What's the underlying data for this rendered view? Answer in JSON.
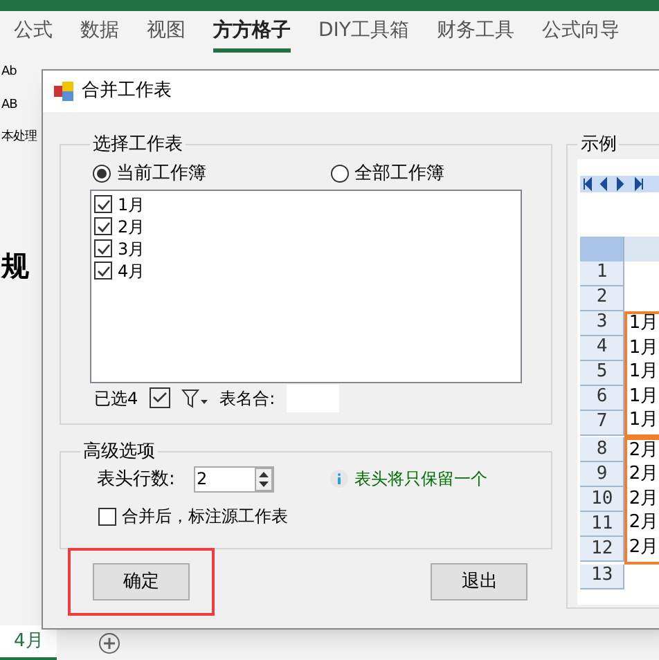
{
  "ribbon": {
    "tabs": [
      {
        "label": "公式",
        "selected": false
      },
      {
        "label": "数据",
        "selected": false
      },
      {
        "label": "视图",
        "selected": false
      },
      {
        "label": "方方格子",
        "selected": true
      },
      {
        "label": "DIY工具箱",
        "selected": false
      },
      {
        "label": "财务工具",
        "selected": false
      },
      {
        "label": "公式向导",
        "selected": false
      }
    ]
  },
  "sheet_fragments": [
    "Ab",
    "AB",
    "本处理",
    "规"
  ],
  "dialog": {
    "title": "合并工作表",
    "select_group": {
      "title": "选择工作表",
      "radios": [
        {
          "label": "当前工作簿",
          "selected": true
        },
        {
          "label": "全部工作簿",
          "selected": false
        }
      ],
      "sheets": [
        {
          "label": "1月",
          "checked": true
        },
        {
          "label": "2月",
          "checked": true
        },
        {
          "label": "3月",
          "checked": true
        },
        {
          "label": "4月",
          "checked": true
        }
      ],
      "selected_count": "已选4",
      "name_filter_label": "表名合:"
    },
    "advanced": {
      "title": "高级选项",
      "header_rows_label": "表头行数:",
      "header_rows_value": "2",
      "info": "表头将只保留一个",
      "mark_source": {
        "label": "合并后，标注源工作表",
        "checked": false
      }
    },
    "buttons": [
      {
        "label": "确定",
        "highlighted": true
      },
      {
        "label": "退出",
        "highlighted": false
      }
    ],
    "example": {
      "title": "示例",
      "rows_before": [
        {
          "number": "1"
        },
        {
          "number": "2"
        }
      ],
      "blocks": [
        {
          "rows": [
            {
              "number": "3",
              "value": "1月"
            },
            {
              "number": "4",
              "value": "1月"
            },
            {
              "number": "5",
              "value": "1月"
            },
            {
              "number": "6",
              "value": "1月"
            },
            {
              "number": "7",
              "value": "1月"
            }
          ]
        },
        {
          "rows": [
            {
              "number": "8",
              "value": "2月"
            },
            {
              "number": "9",
              "value": "2月"
            },
            {
              "number": "10",
              "value": "2月"
            },
            {
              "number": "11",
              "value": "2月"
            },
            {
              "number": "12",
              "value": "2月"
            }
          ]
        }
      ],
      "rows_after": [
        {
          "number": "13"
        }
      ]
    }
  },
  "sheet_tabs": [
    {
      "label": "4月",
      "selected": true
    }
  ]
}
